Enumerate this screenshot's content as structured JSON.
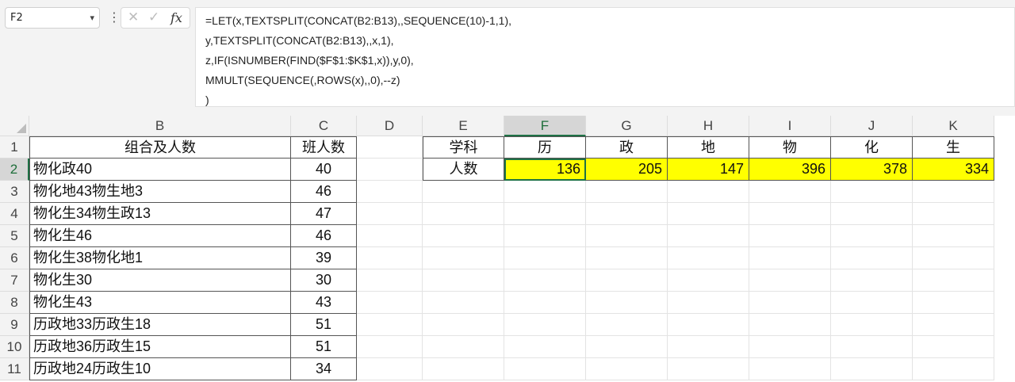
{
  "name_box": "F2",
  "formula_lines": [
    "=LET(x,TEXTSPLIT(CONCAT(B2:B13),,SEQUENCE(10)-1,1),",
    "y,TEXTSPLIT(CONCAT(B2:B13),,x,1),",
    "z,IF(ISNUMBER(FIND($F$1:$K$1,x)),y,0),",
    "MMULT(SEQUENCE(,ROWS(x),,0),--z)",
    ")"
  ],
  "columns": [
    "B",
    "C",
    "D",
    "E",
    "F",
    "G",
    "H",
    "I",
    "J",
    "K"
  ],
  "rows": [
    "1",
    "2",
    "3",
    "4",
    "5",
    "6",
    "7",
    "8",
    "9",
    "10",
    "11"
  ],
  "table1": {
    "header": [
      "组合及人数",
      "班人数"
    ],
    "rows": [
      [
        "物化政40",
        "40"
      ],
      [
        "物化地43物生地3",
        "46"
      ],
      [
        "物化生34物生政13",
        "47"
      ],
      [
        "物化生46",
        "46"
      ],
      [
        "物化生38物化地1",
        "39"
      ],
      [
        "物化生30",
        "30"
      ],
      [
        "物化生43",
        "43"
      ],
      [
        "历政地33历政生18",
        "51"
      ],
      [
        "历政地36历政生15",
        "51"
      ],
      [
        "历政地24历政生10",
        "34"
      ]
    ]
  },
  "table2": {
    "row1_label": "学科",
    "subjects": [
      "历",
      "政",
      "地",
      "物",
      "化",
      "生"
    ],
    "row2_label": "人数",
    "counts": [
      "136",
      "205",
      "147",
      "396",
      "378",
      "334"
    ]
  },
  "colors": {
    "highlight": "#ffff00",
    "selection": "#1e7145"
  }
}
